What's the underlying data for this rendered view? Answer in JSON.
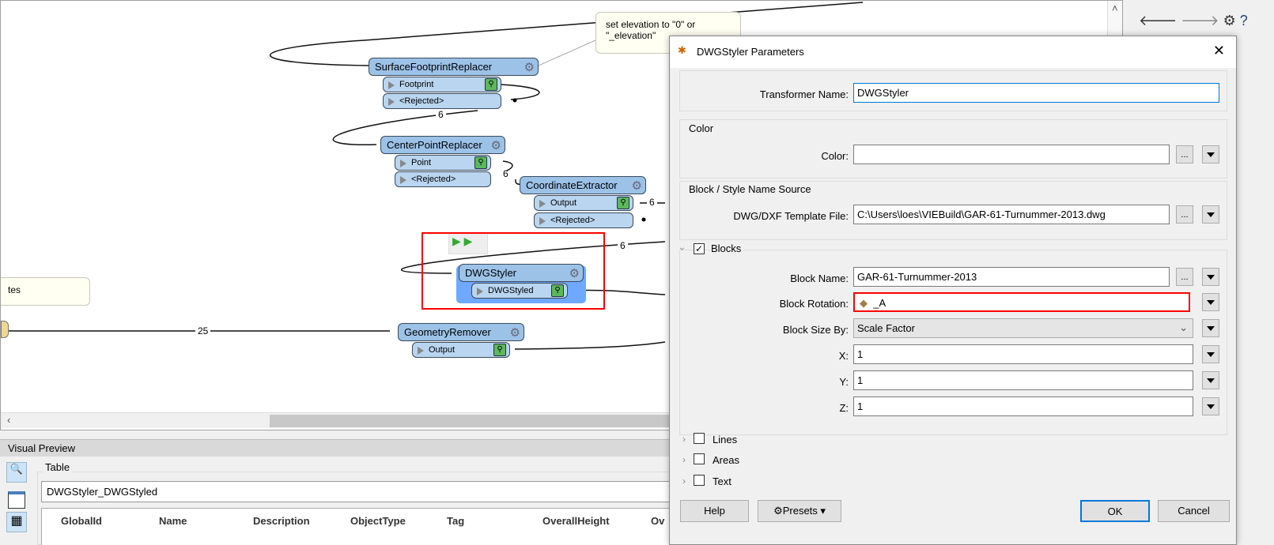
{
  "canvas": {
    "note_top": "set elevation to \"0\" or \"_elevation\"",
    "note_left": "tes",
    "nodes": {
      "surface": {
        "name": "SurfaceFootprintReplacer",
        "ports": [
          "Footprint",
          "<Rejected>"
        ]
      },
      "center": {
        "name": "CenterPointReplacer",
        "ports": [
          "Point",
          "<Rejected>"
        ]
      },
      "coord": {
        "name": "CoordinateExtractor",
        "ports": [
          "Output",
          "<Rejected>"
        ]
      },
      "dwg": {
        "name": "DWGStyler",
        "ports": [
          "DWGStyled"
        ]
      },
      "geom": {
        "name": "GeometryRemover",
        "ports": [
          "Output"
        ]
      }
    },
    "counts": {
      "c1": "6",
      "c2": "6",
      "c3": "6",
      "c4": "6",
      "c5": "25"
    }
  },
  "toolbar": {
    "icons": [
      "arrow-left-icon",
      "arrow-right-icon",
      "gear-user-icon",
      "help-icon"
    ]
  },
  "preview": {
    "title": "Visual Preview",
    "table_label": "Table",
    "table_select": "DWGStyler_DWGStyled",
    "columns": [
      "GlobalId",
      "Name",
      "Description",
      "ObjectType",
      "Tag",
      "OverallHeight",
      "Ov"
    ]
  },
  "dialog": {
    "title": "DWGStyler Parameters",
    "transformer_name_label": "Transformer Name:",
    "transformer_name": "DWGStyler",
    "color_group": "Color",
    "color_label": "Color:",
    "color_value": "",
    "source_group": "Block / Style Name Source",
    "template_label": "DWG/DXF Template File:",
    "template_value": "C:\\Users\\loes\\VIEBuild\\GAR-61-Turnummer-2013.dwg",
    "blocks_group": "Blocks",
    "blocks_checked": true,
    "block_name_label": "Block Name:",
    "block_name": "GAR-61-Turnummer-2013",
    "block_rotation_label": "Block Rotation:",
    "block_rotation": "_A",
    "block_size_label": "Block Size By:",
    "block_size": "Scale Factor",
    "x_label": "X:",
    "x": "1",
    "y_label": "Y:",
    "y": "1",
    "z_label": "Z:",
    "z": "1",
    "lines": "Lines",
    "areas": "Areas",
    "text": "Text",
    "help": "Help",
    "presets": "Presets",
    "ok": "OK",
    "cancel": "Cancel",
    "ellipsis": "..."
  },
  "colors": {
    "accent": "#0078d7",
    "highlight": "#ff0000",
    "selected_node": "#6fa8ff"
  }
}
